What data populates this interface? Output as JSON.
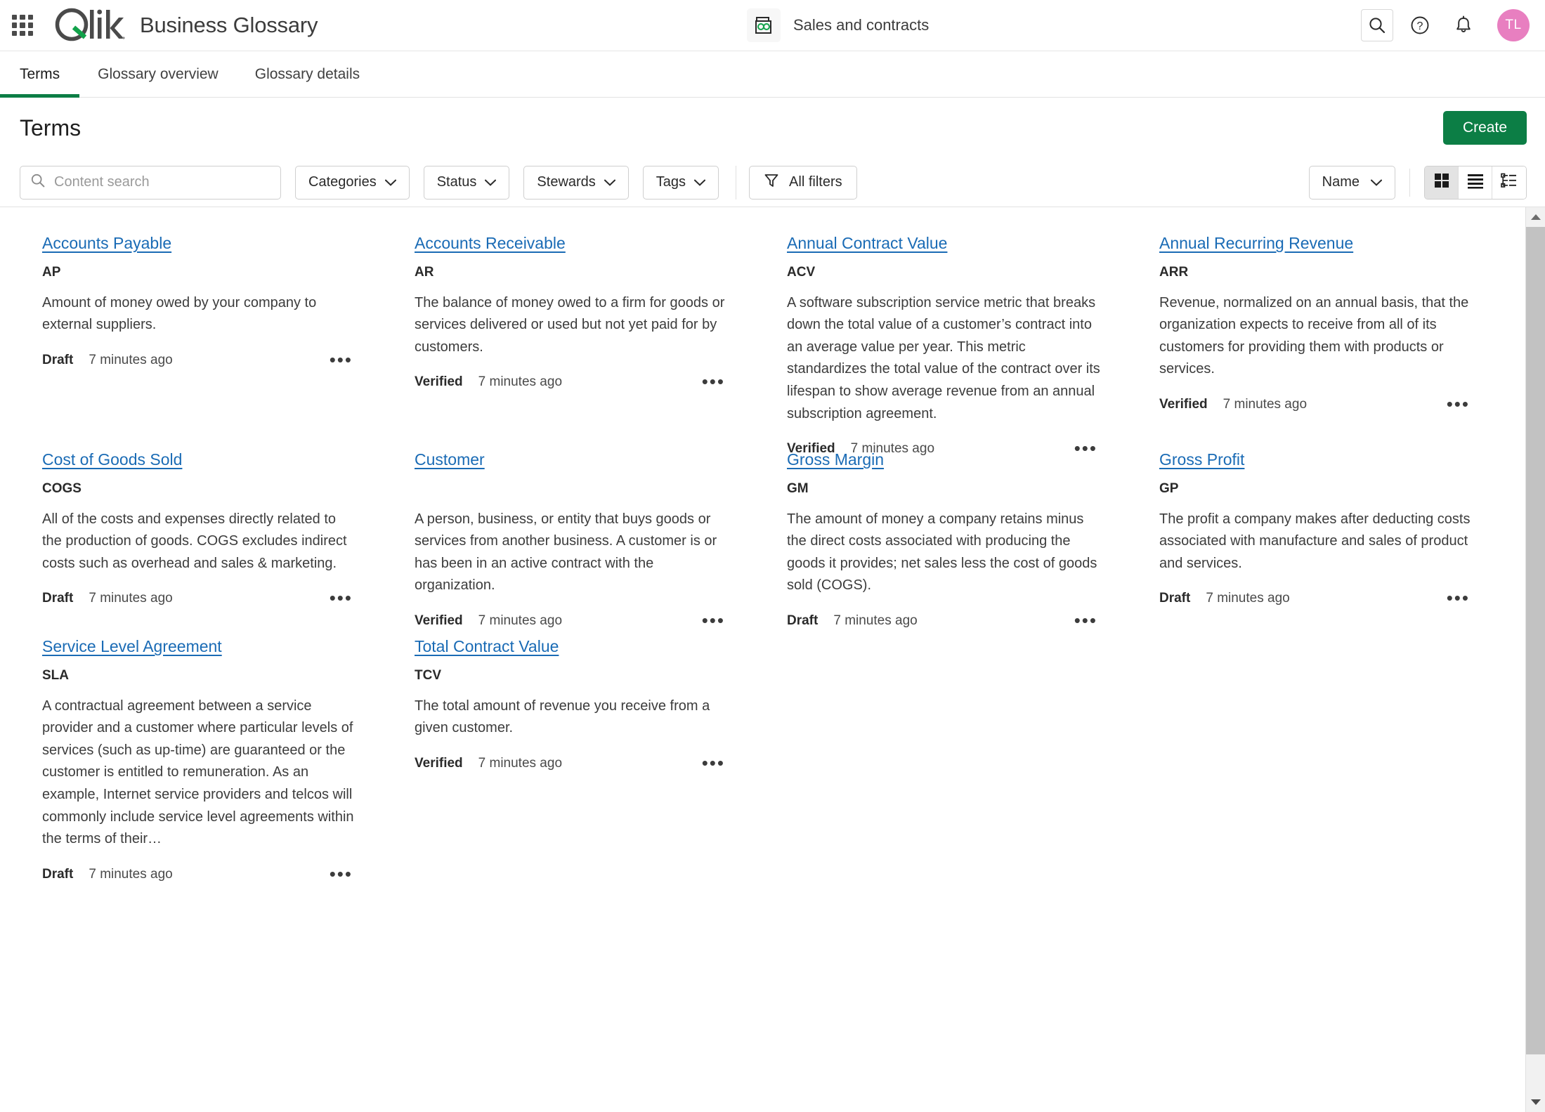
{
  "header": {
    "app_title": "Business Glossary",
    "logo_text": "Qlik",
    "space_name": "Sales and contracts",
    "avatar_initials": "TL",
    "icons": {
      "waffle": "app-launcher-icon",
      "space": "glossary-icon",
      "search": "search-icon",
      "help": "help-icon",
      "notifications": "bell-icon"
    }
  },
  "tabs": [
    {
      "label": "Terms",
      "active": true
    },
    {
      "label": "Glossary overview",
      "active": false
    },
    {
      "label": "Glossary details",
      "active": false
    }
  ],
  "page": {
    "title": "Terms",
    "create_label": "Create"
  },
  "toolbar": {
    "search_placeholder": "Content search",
    "search_value": "",
    "filters": [
      {
        "label": "Categories"
      },
      {
        "label": "Status"
      },
      {
        "label": "Stewards"
      },
      {
        "label": "Tags"
      }
    ],
    "all_filters_label": "All filters",
    "sort_label": "Name",
    "views": [
      {
        "name": "grid-view",
        "active": true
      },
      {
        "name": "list-view",
        "active": false
      },
      {
        "name": "tree-view",
        "active": false
      }
    ]
  },
  "terms": [
    {
      "name": "Accounts Payable",
      "abbreviation": "AP",
      "description": "Amount of money owed by your company to external suppliers.",
      "status": "Draft",
      "updated": "7 minutes ago"
    },
    {
      "name": "Accounts Receivable",
      "abbreviation": "AR",
      "description": "The balance of money owed to a firm for goods or services delivered or used but not yet paid for by customers.",
      "status": "Verified",
      "updated": "7 minutes ago"
    },
    {
      "name": "Annual Contract Value",
      "abbreviation": "ACV",
      "description": "A software subscription service metric that breaks down the total value of a customer’s contract into an average value per year. This metric standardizes the total value of the contract over its lifespan to show average revenue from an annual subscription agreement.",
      "status": "Verified",
      "updated": "7 minutes ago"
    },
    {
      "name": "Annual Recurring Revenue",
      "abbreviation": "ARR",
      "description": "Revenue, normalized on an annual basis, that the organization expects to receive from all of its customers for providing them with products or services.",
      "status": "Verified",
      "updated": "7 minutes ago"
    },
    {
      "name": "Cost of Goods Sold",
      "abbreviation": "COGS",
      "description": "All of the costs and expenses directly related to the production of goods. COGS excludes indirect costs such as overhead and sales & marketing.",
      "status": "Draft",
      "updated": "7 minutes ago"
    },
    {
      "name": "Customer",
      "abbreviation": "",
      "description": "A person, business, or entity that buys goods or services from another business. A customer is or has been in an active contract with the organization.",
      "status": "Verified",
      "updated": "7 minutes ago"
    },
    {
      "name": "Gross Margin",
      "abbreviation": "GM",
      "description": "The amount of money a company retains minus the direct costs associated with producing the goods it provides; net sales less the cost of goods sold (COGS).",
      "status": "Draft",
      "updated": "7 minutes ago"
    },
    {
      "name": "Gross Profit",
      "abbreviation": "GP",
      "description": "The profit a company makes after deducting costs associated with manufacture and sales of product and services.",
      "status": "Draft",
      "updated": "7 minutes ago"
    },
    {
      "name": "Service Level Agreement",
      "abbreviation": "SLA",
      "description": "A contractual agreement between a service provider and a customer where particular levels of services (such as up-time) are guaranteed or the customer is entitled to remuneration. As an example, Internet service providers and telcos will commonly include service level agreements within the terms of their…",
      "status": "Draft",
      "updated": "7 minutes ago"
    },
    {
      "name": "Total Contract Value",
      "abbreviation": "TCV",
      "description": "The total amount of revenue you receive from a given customer.",
      "status": "Verified",
      "updated": "7 minutes ago"
    }
  ],
  "colors": {
    "brand_green": "#0c7e45",
    "link_blue": "#1a6bb5",
    "avatar_pink": "#e87fc0"
  }
}
